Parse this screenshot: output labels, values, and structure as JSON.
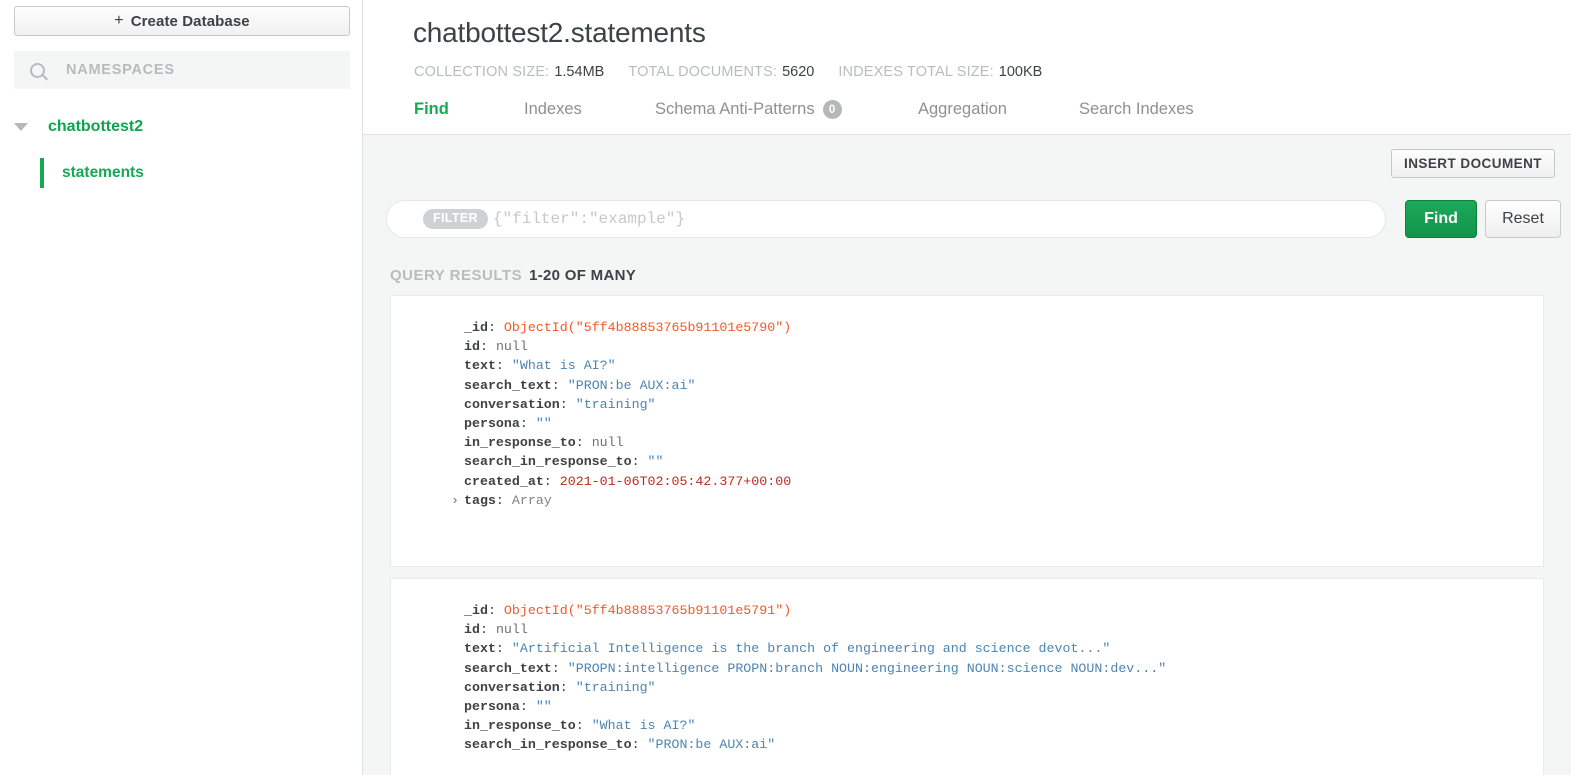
{
  "sidebar": {
    "create_database_button": "Create Database",
    "create_database_plus": "+",
    "search": {
      "icon": "search-icon",
      "placeholder": "NAMESPACES"
    },
    "database": {
      "name": "chatbottest2",
      "expanded": true
    },
    "collection": {
      "name": "statements",
      "selected": true
    }
  },
  "header": {
    "title": "chatbottest2.statements",
    "stats": [
      {
        "label": "COLLECTION SIZE:",
        "value": "1.54MB"
      },
      {
        "label": "TOTAL DOCUMENTS:",
        "value": "5620"
      },
      {
        "label": "INDEXES TOTAL SIZE:",
        "value": "100KB"
      }
    ],
    "tabs": [
      {
        "label": "Find",
        "active": true,
        "badge": null
      },
      {
        "label": "Indexes",
        "active": false,
        "badge": null
      },
      {
        "label": "Schema Anti-Patterns",
        "active": false,
        "badge": "0"
      },
      {
        "label": "Aggregation",
        "active": false,
        "badge": null
      },
      {
        "label": "Search Indexes",
        "active": false,
        "badge": null
      }
    ]
  },
  "toolbar": {
    "insert_document_label": "INSERT DOCUMENT"
  },
  "query": {
    "filter_chip": "FILTER",
    "filter_placeholder": "{\"filter\":\"example\"}",
    "filter_value": "",
    "find_label": "Find",
    "reset_label": "Reset"
  },
  "results": {
    "label": "QUERY RESULTS",
    "count": "1-20 OF MANY",
    "documents": [
      {
        "fields": [
          {
            "key": "_id",
            "value": "ObjectId(\"5ff4b88853765b91101e5790\")",
            "kind": "oid",
            "expandable": false
          },
          {
            "key": "id",
            "value": "null",
            "kind": "null",
            "expandable": false
          },
          {
            "key": "text",
            "value": "\"What is AI?\"",
            "kind": "string",
            "expandable": false
          },
          {
            "key": "search_text",
            "value": "\"PRON:be AUX:ai\"",
            "kind": "string",
            "expandable": false
          },
          {
            "key": "conversation",
            "value": "\"training\"",
            "kind": "string",
            "expandable": false
          },
          {
            "key": "persona",
            "value": "\"\"",
            "kind": "string",
            "expandable": false
          },
          {
            "key": "in_response_to",
            "value": "null",
            "kind": "null",
            "expandable": false
          },
          {
            "key": "search_in_response_to",
            "value": "\"\"",
            "kind": "string",
            "expandable": false
          },
          {
            "key": "created_at",
            "value": "2021-01-06T02:05:42.377+00:00",
            "kind": "date",
            "expandable": false
          },
          {
            "key": "tags",
            "value": "Array",
            "kind": "type",
            "expandable": true,
            "expander": "›"
          }
        ]
      },
      {
        "fields": [
          {
            "key": "_id",
            "value": "ObjectId(\"5ff4b88853765b91101e5791\")",
            "kind": "oid",
            "expandable": false
          },
          {
            "key": "id",
            "value": "null",
            "kind": "null",
            "expandable": false
          },
          {
            "key": "text",
            "value": "\"Artificial Intelligence is the branch of engineering and science devot...\"",
            "kind": "string",
            "expandable": false
          },
          {
            "key": "search_text",
            "value": "\"PROPN:intelligence PROPN:branch NOUN:engineering NOUN:science NOUN:dev...\"",
            "kind": "string",
            "expandable": false
          },
          {
            "key": "conversation",
            "value": "\"training\"",
            "kind": "string",
            "expandable": false
          },
          {
            "key": "persona",
            "value": "\"\"",
            "kind": "string",
            "expandable": false
          },
          {
            "key": "in_response_to",
            "value": "\"What is AI?\"",
            "kind": "string",
            "expandable": false
          },
          {
            "key": "search_in_response_to",
            "value": "\"PRON:be AUX:ai\"",
            "kind": "string",
            "expandable": false
          }
        ]
      }
    ]
  },
  "colors": {
    "brand_green": "#13aa52",
    "text_dark": "#3d4247",
    "text_muted": "#b9bcbf",
    "string_blue": "#4c84b3",
    "objectid_orange": "#f05a28",
    "date_red": "#b82b1e",
    "body_bg": "#f4f6f6"
  }
}
